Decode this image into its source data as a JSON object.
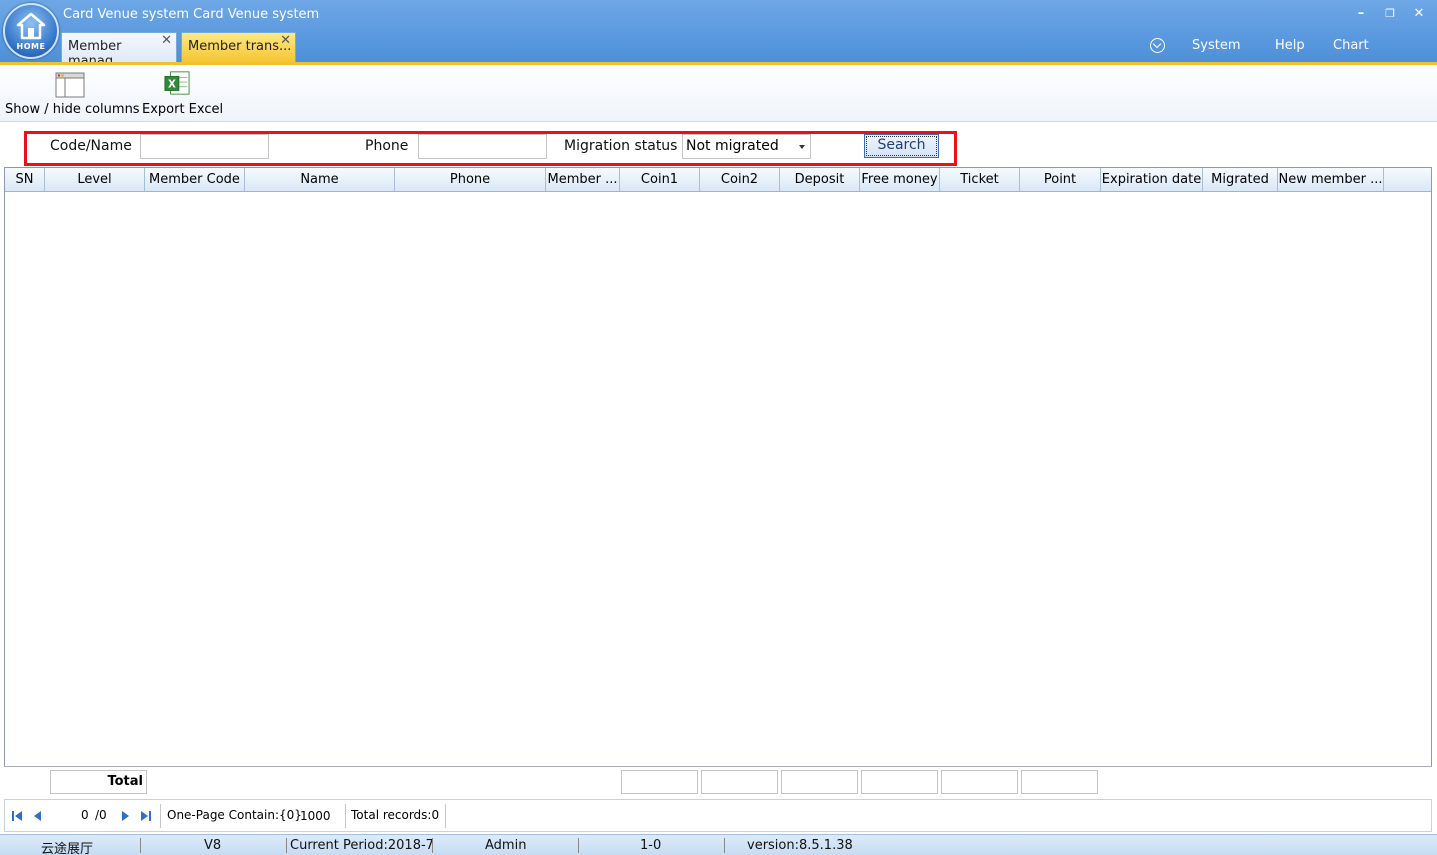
{
  "window": {
    "title": "Card Venue system Card Venue system",
    "home_label": "HOME",
    "minimize": "–",
    "restore": "❐",
    "close": "✕"
  },
  "tabs": [
    {
      "label": "Member manag..."
    },
    {
      "label": "Member trans..."
    }
  ],
  "tab_close_glyph": "✕",
  "menu": {
    "system": "System",
    "help": "Help",
    "chart": "Chart"
  },
  "toolbar": {
    "show_hide": "Show / hide columns",
    "export": "Export Excel"
  },
  "search": {
    "code_label": "Code/Name",
    "code_value": "",
    "phone_label": "Phone",
    "phone_value": "",
    "migration_label": "Migration status",
    "migration_value": "Not migrated",
    "button": "Search"
  },
  "grid": {
    "columns": [
      "SN",
      "Level",
      "Member Code",
      "Name",
      "Phone",
      "Member ...",
      "Coin1",
      "Coin2",
      "Deposit",
      "Free money",
      "Ticket",
      "Point",
      "Expiration date",
      "Migrated",
      "New member ..."
    ],
    "rows": [],
    "total_label": "Total"
  },
  "pager": {
    "current_page": "0",
    "page_total": "/0",
    "page_size_label": "One-Page Contain:{0}",
    "page_size": "1000",
    "total_records": "Total records:0"
  },
  "status": {
    "venue": "云途展厅",
    "version_short": "V8",
    "period": "Current Period:2018-7",
    "user": "Admin",
    "terminal": "1-0",
    "version": "version:8.5.1.38"
  },
  "colors": {
    "titlebar": "#5b9ae0",
    "active_tab": "#f4c531",
    "highlight_box": "#e8101a"
  }
}
